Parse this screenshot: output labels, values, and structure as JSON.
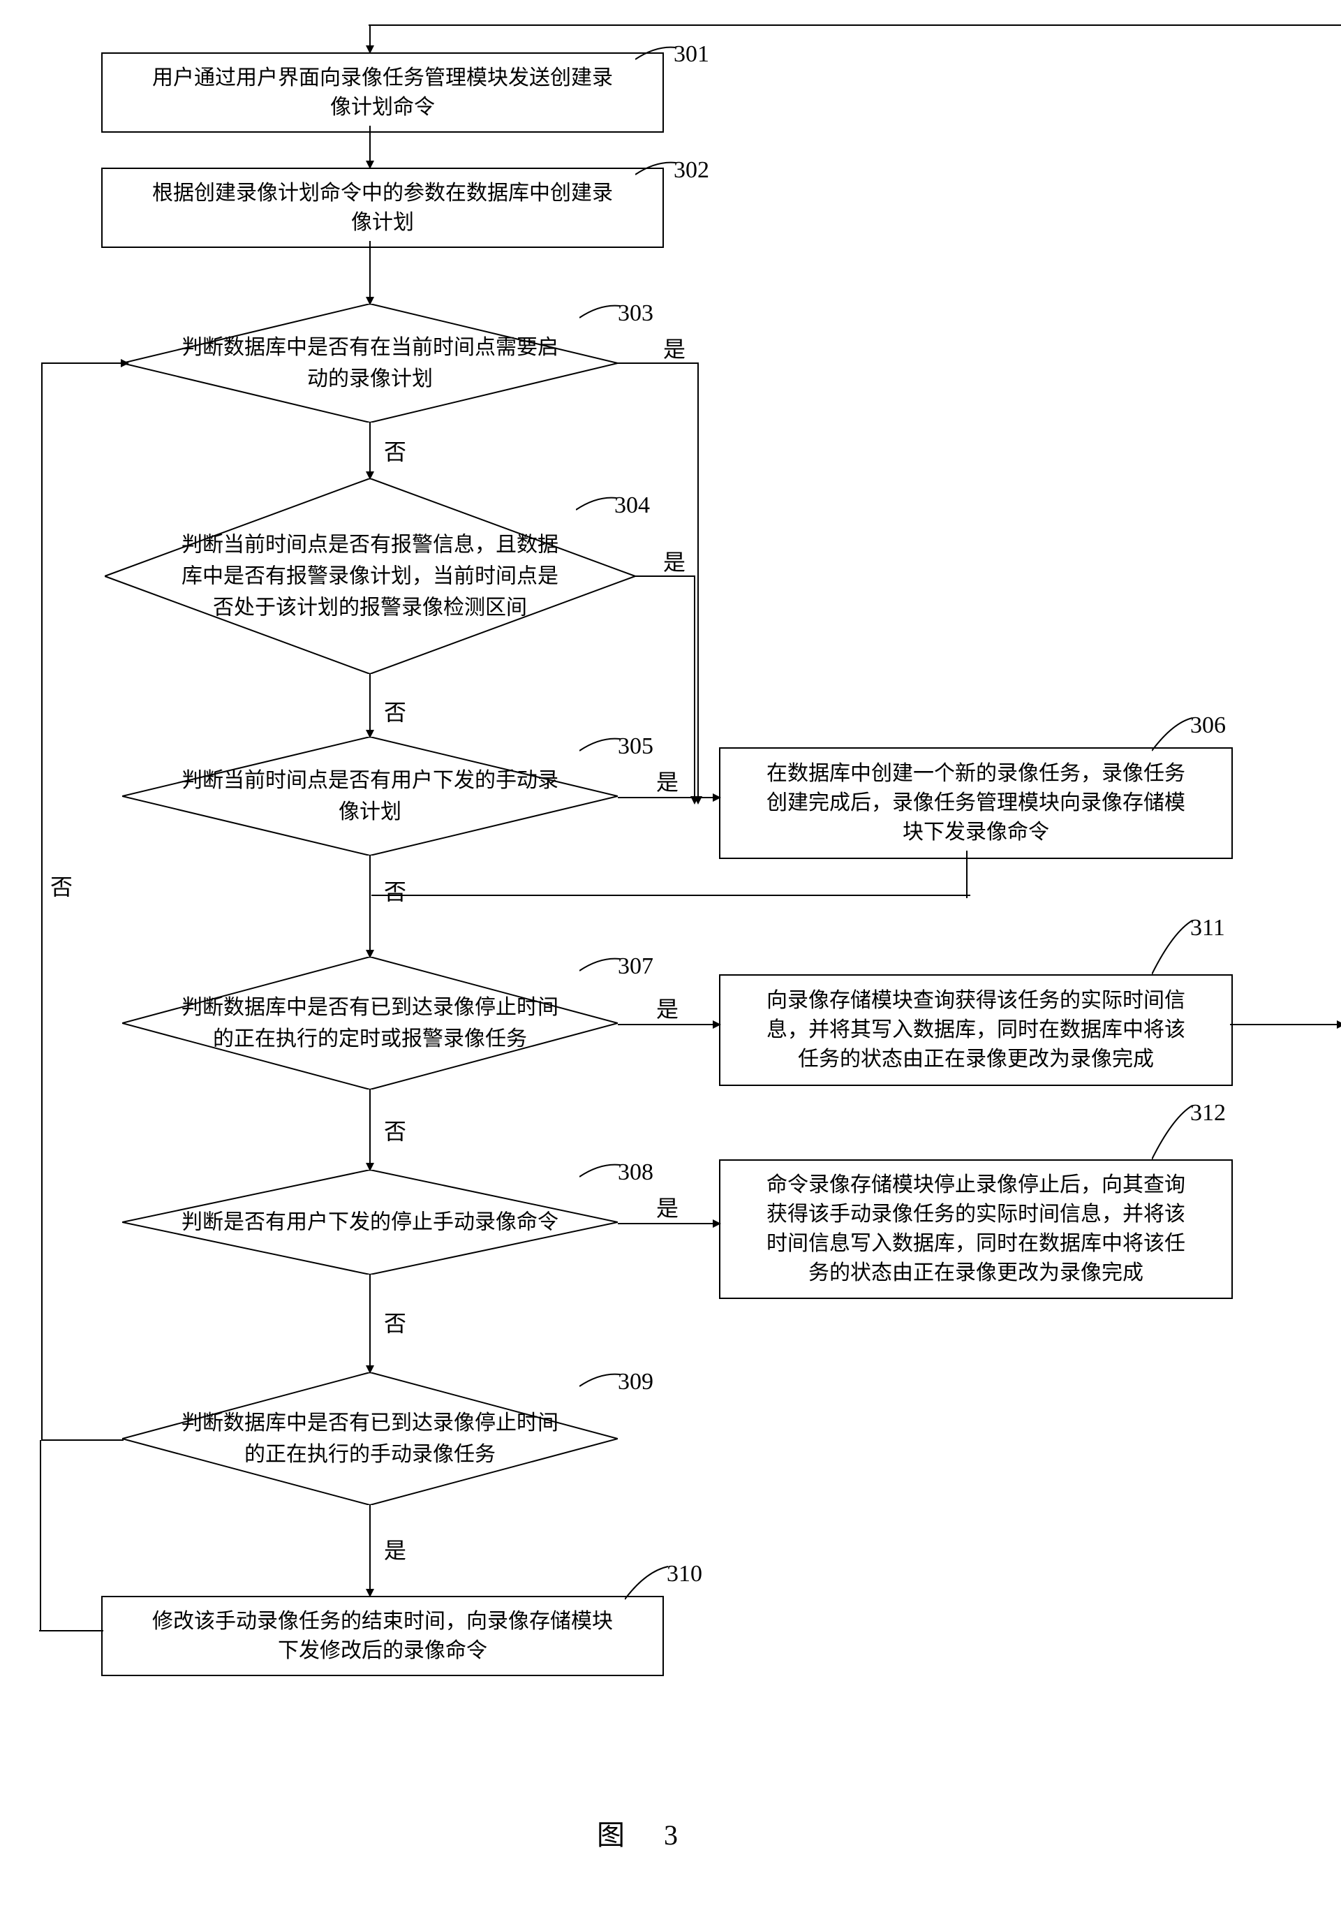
{
  "nodes": {
    "n301": {
      "label": "301",
      "text": "用户通过用户界面向录像任务管理模块发送创建录\n像计划命令"
    },
    "n302": {
      "label": "302",
      "text": "根据创建录像计划命令中的参数在数据库中创建录\n像计划"
    },
    "n303": {
      "label": "303",
      "text": "判断数据库中是否有在当前时间点需要启\n动的录像计划"
    },
    "n304": {
      "label": "304",
      "text": "判断当前时间点是否有报警信息，且数据\n库中是否有报警录像计划，当前时间点是\n否处于该计划的报警录像检测区间"
    },
    "n305": {
      "label": "305",
      "text": "判断当前时间点是否有用户下发的手动录\n像计划"
    },
    "n306": {
      "label": "306",
      "text": "在数据库中创建一个新的录像任务，录像任务\n创建完成后，录像任务管理模块向录像存储模\n块下发录像命令"
    },
    "n307": {
      "label": "307",
      "text": "判断数据库中是否有已到达录像停止时间\n的正在执行的定时或报警录像任务"
    },
    "n308": {
      "label": "308",
      "text": "判断是否有用户下发的停止手动录像命令"
    },
    "n309": {
      "label": "309",
      "text": "判断数据库中是否有已到达录像停止时间\n的正在执行的手动录像任务"
    },
    "n310": {
      "label": "310",
      "text": "修改该手动录像任务的结束时间，向录像存储模块\n下发修改后的录像命令"
    },
    "n311": {
      "label": "311",
      "text": "向录像存储模块查询获得该任务的实际时间信\n息，并将其写入数据库，同时在数据库中将该\n任务的状态由正在录像更改为录像完成"
    },
    "n312": {
      "label": "312",
      "text": "命令录像存储模块停止录像停止后，向其查询\n获得该手动录像任务的实际时间信息，并将该\n时间信息写入数据库，同时在数据库中将该任\n务的状态由正在录像更改为录像完成"
    }
  },
  "edges": {
    "yes": "是",
    "no": "否"
  },
  "caption": "图　3"
}
